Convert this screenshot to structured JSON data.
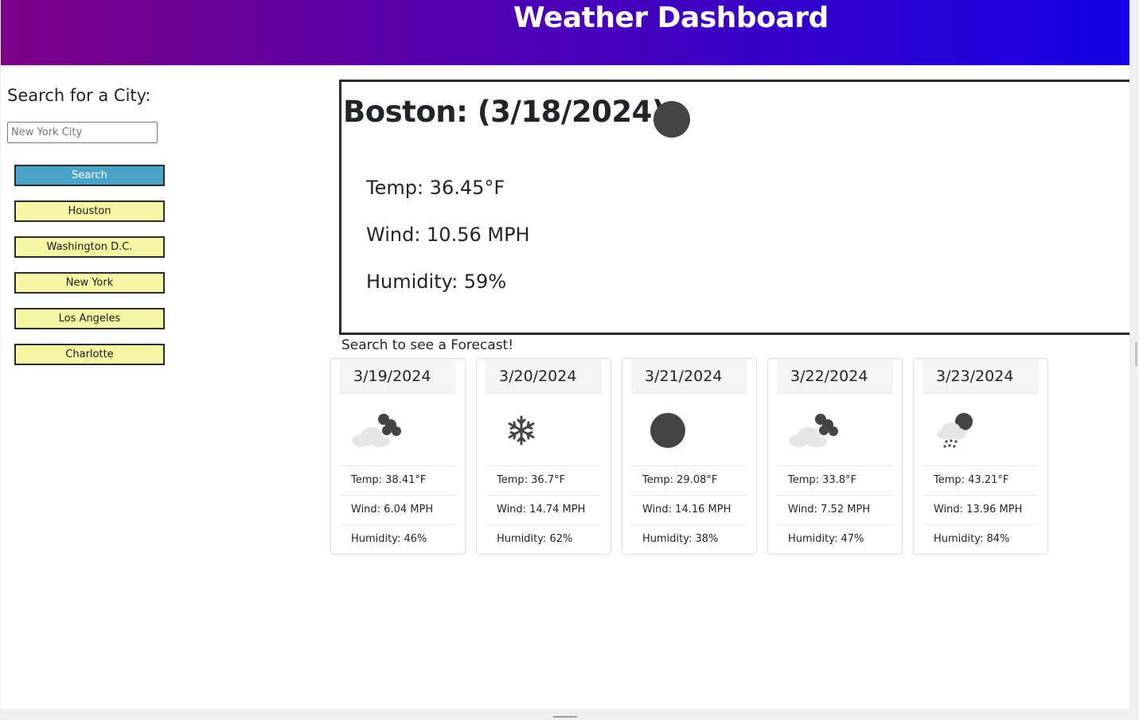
{
  "header": {
    "title": "Weather Dashboard"
  },
  "search": {
    "heading": "Search for a City:",
    "placeholder": "New York City",
    "button_label": "Search"
  },
  "history": [
    "Houston",
    "Washington D.C.",
    "New York",
    "Los Angeles",
    "Charlotte"
  ],
  "current": {
    "title": "Boston: (3/18/2024)",
    "icon": "clear-night-icon",
    "temp": "Temp: 36.45°F",
    "wind": "Wind: 10.56 MPH",
    "humidity": "Humidity: 59%"
  },
  "forecast": {
    "heading": "Search to see a Forecast!",
    "days": [
      {
        "date": "3/19/2024",
        "icon": "cloudy-night-icon",
        "temp": "Temp: 38.41°F",
        "wind": "Wind: 6.04 MPH",
        "humidity": "Humidity: 46%"
      },
      {
        "date": "3/20/2024",
        "icon": "snowflake-icon",
        "temp": "Temp: 36.7°F",
        "wind": "Wind: 14.74 MPH",
        "humidity": "Humidity: 62%"
      },
      {
        "date": "3/21/2024",
        "icon": "clear-night-icon",
        "temp": "Temp: 29.08°F",
        "wind": "Wind: 14.16 MPH",
        "humidity": "Humidity: 38%"
      },
      {
        "date": "3/22/2024",
        "icon": "cloudy-night-icon",
        "temp": "Temp: 33.8°F",
        "wind": "Wind: 7.52 MPH",
        "humidity": "Humidity: 47%"
      },
      {
        "date": "3/23/2024",
        "icon": "rain-night-icon",
        "temp": "Temp: 43.21°F",
        "wind": "Wind: 13.96 MPH",
        "humidity": "Humidity: 84%"
      }
    ]
  },
  "colors": {
    "header_gradient_start": "#7d0087",
    "header_gradient_end": "#1400e6",
    "search_button": "#4aa3c9",
    "history_button": "#f6f6a5",
    "icon_dark": "#444444"
  }
}
